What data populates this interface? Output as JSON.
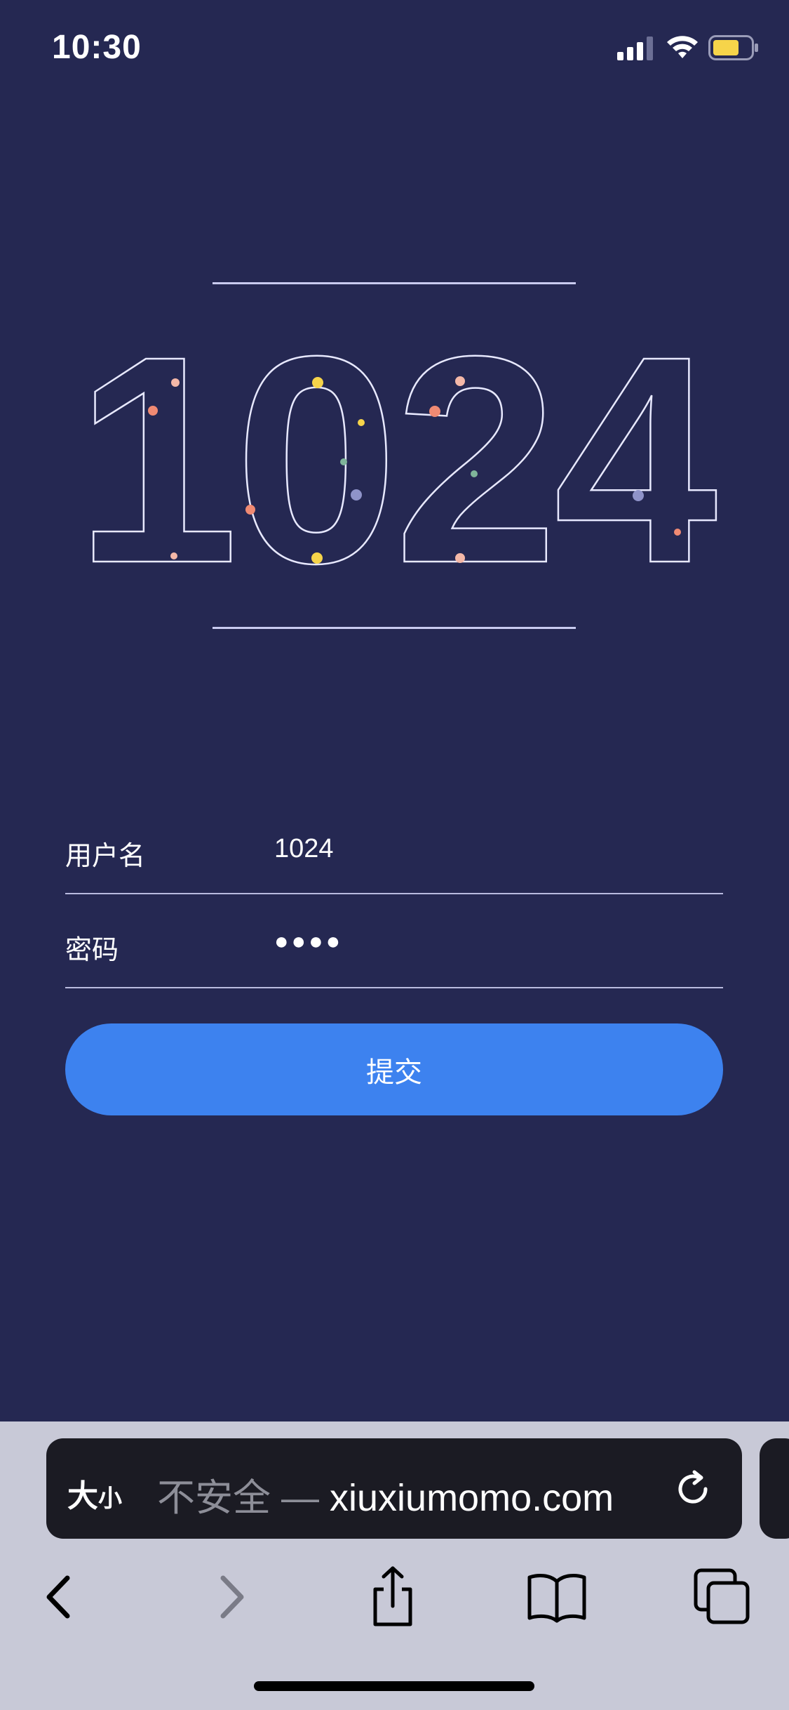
{
  "status_bar": {
    "time": "10:30",
    "icons": [
      "signal-icon",
      "wifi-icon",
      "battery-icon"
    ],
    "battery_color": "#f6d44a"
  },
  "hero": {
    "title": "1024"
  },
  "form": {
    "username_label": "用户名",
    "username_value": "1024",
    "password_label": "密码",
    "password_value": "●●●●",
    "submit_label": "提交"
  },
  "browser": {
    "text_size_big": "大",
    "text_size_small": "小",
    "security_label": "不安全 — ",
    "domain": "xiuxiumomo.com",
    "toolbar_icons": [
      "back-icon",
      "forward-icon",
      "share-icon",
      "bookmarks-icon",
      "tabs-icon"
    ]
  },
  "colors": {
    "background": "#252852",
    "accent": "#3d82ef",
    "browser_chrome": "#c8c9d7"
  }
}
